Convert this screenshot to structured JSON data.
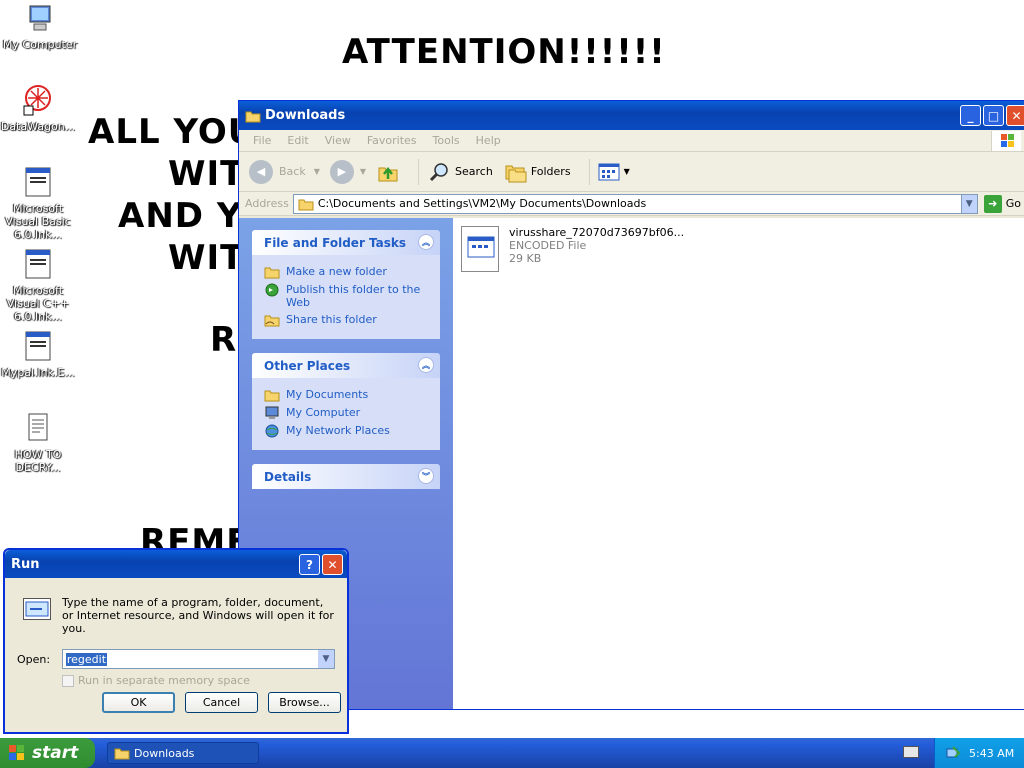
{
  "desktop": {
    "icons": [
      {
        "label": "My Computer"
      },
      {
        "label": "DataWagon..."
      },
      {
        "label": "Microsoft Visual Basic 6.0.lnk..."
      },
      {
        "label": "Microsoft Visual C++ 6.0.lnk..."
      },
      {
        "label": "Mypal.lnk.E..."
      },
      {
        "label": "HOW TO DECRY..."
      }
    ],
    "ransom_note": {
      "title": "ATTENTION!!!!!!",
      "lines": [
        "ALL YOU",
        "WIT",
        "AND YO",
        "WIT",
        "R",
        "REME"
      ]
    }
  },
  "explorer": {
    "title": "Downloads",
    "menu": [
      "File",
      "Edit",
      "View",
      "Favorites",
      "Tools",
      "Help"
    ],
    "toolbar": {
      "back": "Back",
      "search": "Search",
      "folders": "Folders"
    },
    "address": {
      "label": "Address",
      "value": "C:\\Documents and Settings\\VM2\\My Documents\\Downloads",
      "go": "Go"
    },
    "panels": {
      "file_tasks": {
        "title": "File and Folder Tasks",
        "items": [
          "Make a new folder",
          "Publish this folder to the Web",
          "Share this folder"
        ]
      },
      "other_places": {
        "title": "Other Places",
        "items": [
          "My Documents",
          "My Computer",
          "My Network Places"
        ]
      },
      "details": {
        "title": "Details"
      }
    },
    "file": {
      "name": "virusshare_72070d73697bf06...",
      "type": "ENCODED File",
      "size": "29 KB"
    }
  },
  "run_dialog": {
    "title": "Run",
    "description": "Type the name of a program, folder, document, or Internet resource, and Windows will open it for you.",
    "open_label": "Open:",
    "open_value": "regedit",
    "checkbox_label": "Run in separate memory space",
    "buttons": {
      "ok": "OK",
      "cancel": "Cancel",
      "browse": "Browse..."
    }
  },
  "taskbar": {
    "start": "start",
    "task": "Downloads",
    "clock": "5:43 AM"
  },
  "colors": {
    "xp_blue": "#0a4bc1",
    "taskpane": "#6375d6",
    "link": "#215dc6",
    "start_green": "#2f8d2f"
  }
}
